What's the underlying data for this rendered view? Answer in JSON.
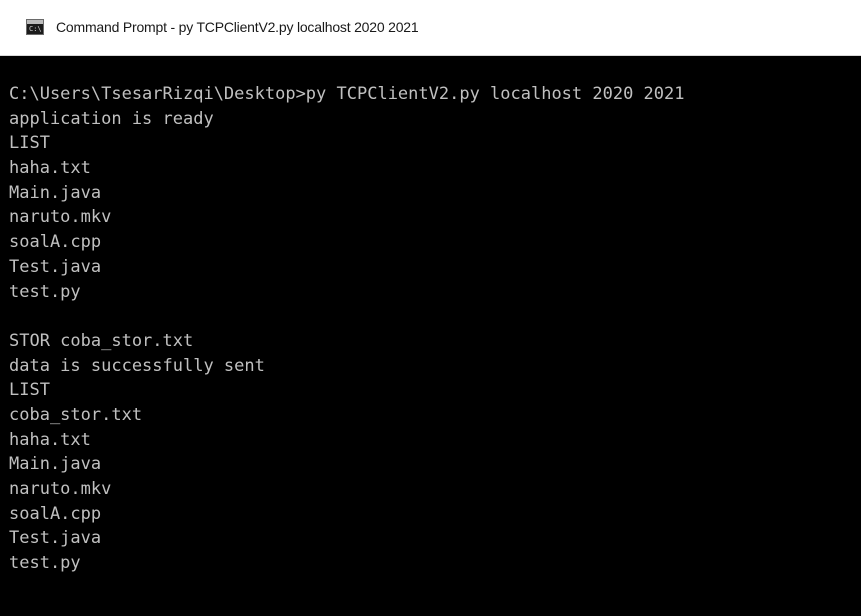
{
  "window": {
    "title": "Command Prompt - py  TCPClientV2.py localhost 2020 2021",
    "icon": "command-prompt-icon",
    "icon_glyph": "C:\\"
  },
  "console": {
    "text_color": "#c0c0c0",
    "background_color": "#000000",
    "lines": [
      "C:\\Users\\TsesarRizqi\\Desktop>py TCPClientV2.py localhost 2020 2021",
      "application is ready",
      "LIST",
      "haha.txt",
      "Main.java",
      "naruto.mkv",
      "soalA.cpp",
      "Test.java",
      "test.py",
      "",
      "STOR coba_stor.txt",
      "data is successfully sent",
      "LIST",
      "coba_stor.txt",
      "haha.txt",
      "Main.java",
      "naruto.mkv",
      "soalA.cpp",
      "Test.java",
      "test.py"
    ]
  }
}
